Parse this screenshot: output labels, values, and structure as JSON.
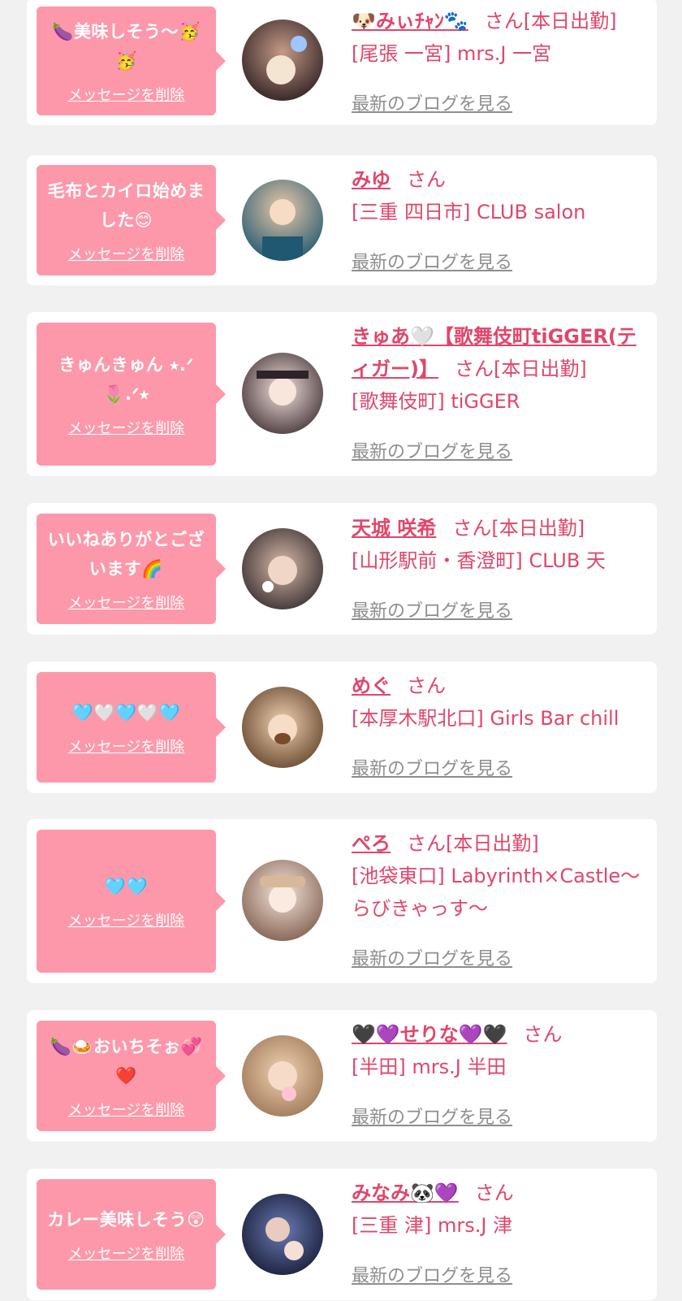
{
  "delete_label": "メッセージを削除",
  "blog_label": "最新のブログを見る",
  "colors": {
    "accent": "#e0466b",
    "bubble": "#fd98aa",
    "link_gray": "#8e8e8e",
    "background": "#f1f1f1"
  },
  "cards": [
    {
      "message": "🍆美味しそう〜🥳🥳",
      "name": "🐶みぃﾁｬﾝ🐾",
      "suffix": "さん[本日出勤]",
      "shop": "[尾張 一宮] mrs.J 一宮"
    },
    {
      "message": "毛布とカイロ始めました😊",
      "name": "みゆ",
      "suffix": "さん",
      "shop": "[三重 四日市] CLUB salon"
    },
    {
      "message": "きゅんきゅん ⭑.ᐟ🌷.ᐟ⭑",
      "name": "きゅあ🤍【歌舞伎町tiGGER(ティガー)】",
      "suffix": "さん[本日出勤]",
      "shop": "[歌舞伎町] tiGGER"
    },
    {
      "message": "いいねありがとございます🌈",
      "name": "天城 咲希",
      "suffix": "さん[本日出勤]",
      "shop": "[山形駅前・香澄町] CLUB 天"
    },
    {
      "message": "🩵🤍🩵🤍🩵",
      "name": "めぐ",
      "suffix": "さん",
      "shop": "[本厚木駅北口] Girls Bar chill"
    },
    {
      "message": "🩵🩵",
      "name": "ぺろ",
      "suffix": "さん[本日出勤]",
      "shop": "[池袋東口] Labyrinth×Castle〜らびきゃっす〜"
    },
    {
      "message": "🍆🍛おいちそぉ💞❤️",
      "name": "🖤💜せりな💜🖤",
      "suffix": "さん",
      "shop": "[半田] mrs.J 半田"
    },
    {
      "message": "カレー美味しそう😲",
      "name": "みなみ🐼💜",
      "suffix": "さん",
      "shop": "[三重 津] mrs.J 津"
    }
  ]
}
